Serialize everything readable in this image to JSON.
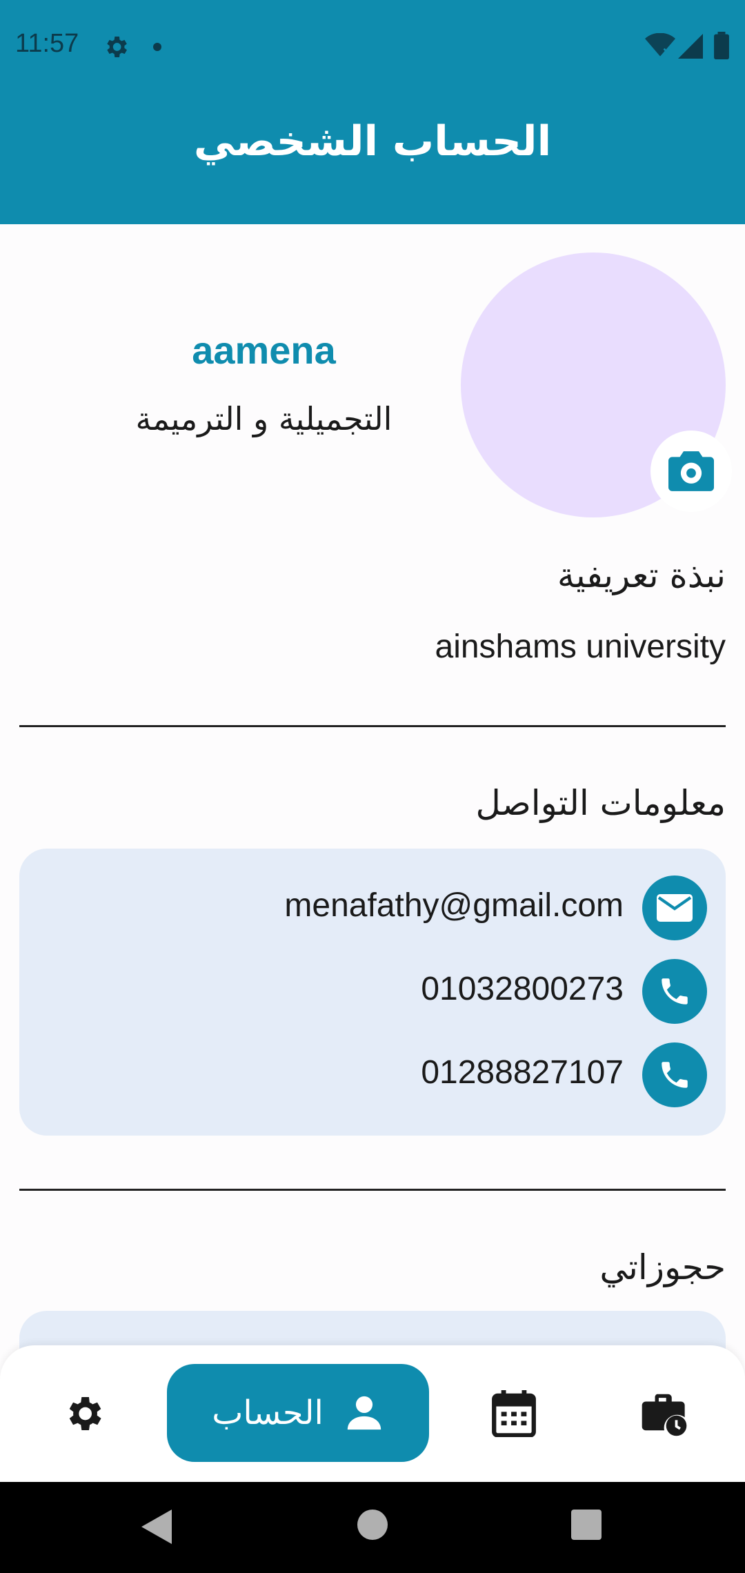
{
  "status_bar": {
    "time": "11:57"
  },
  "header": {
    "title": "الحساب الشخصي"
  },
  "profile": {
    "name": "aamena",
    "specialty": "التجميلية و الترميمة",
    "avatar_color": "#e9ddfe"
  },
  "bio": {
    "title": "نبذة تعريفية",
    "text": "ainshams university"
  },
  "contact": {
    "title": "معلومات التواصل",
    "items": [
      {
        "icon": "email-icon",
        "value": "menafathy@gmail.com"
      },
      {
        "icon": "phone-icon",
        "value": "01032800273"
      },
      {
        "icon": "phone-icon",
        "value": "01288827107"
      }
    ]
  },
  "bookings": {
    "title": "حجوزاتي"
  },
  "bottom_nav": {
    "items": [
      {
        "icon": "settings-icon",
        "label": ""
      },
      {
        "icon": "person-icon",
        "label": "الحساب",
        "active": true
      },
      {
        "icon": "calendar-icon",
        "label": ""
      },
      {
        "icon": "briefcase-clock-icon",
        "label": ""
      }
    ]
  },
  "colors": {
    "primary": "#0f8cae",
    "card_bg": "#e4ecf8"
  }
}
